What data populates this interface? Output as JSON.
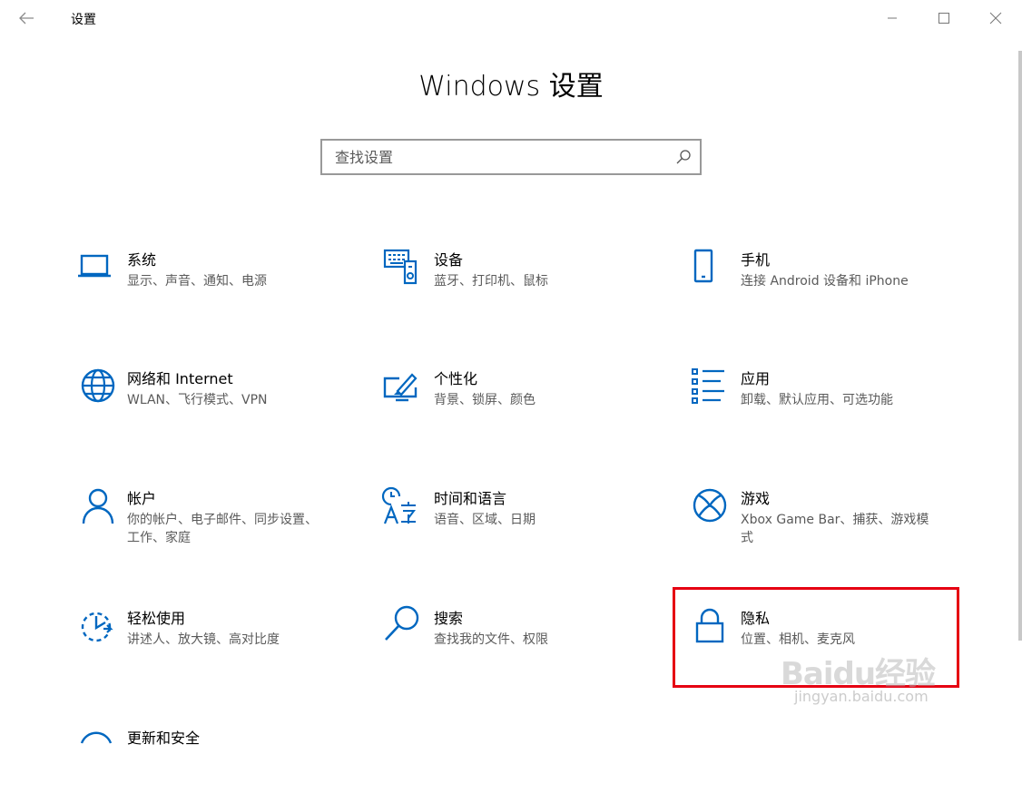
{
  "window": {
    "title": "设置"
  },
  "header": {
    "title": "Windows 设置"
  },
  "search": {
    "placeholder": "查找设置"
  },
  "accent": "#0067c0",
  "tiles": [
    {
      "name": "系统",
      "desc": "显示、声音、通知、电源",
      "icon": "laptop-icon"
    },
    {
      "name": "设备",
      "desc": "蓝牙、打印机、鼠标",
      "icon": "devices-icon"
    },
    {
      "name": "手机",
      "desc": "连接 Android 设备和 iPhone",
      "icon": "phone-icon"
    },
    {
      "name": "网络和 Internet",
      "desc": "WLAN、飞行模式、VPN",
      "icon": "globe-icon"
    },
    {
      "name": "个性化",
      "desc": "背景、锁屏、颜色",
      "icon": "personalization-icon"
    },
    {
      "name": "应用",
      "desc": "卸载、默认应用、可选功能",
      "icon": "apps-list-icon"
    },
    {
      "name": "帐户",
      "desc": "你的帐户、电子邮件、同步设置、工作、家庭",
      "icon": "person-icon"
    },
    {
      "name": "时间和语言",
      "desc": "语音、区域、日期",
      "icon": "time-language-icon"
    },
    {
      "name": "游戏",
      "desc": "Xbox Game Bar、捕获、游戏模式",
      "icon": "xbox-icon"
    },
    {
      "name": "轻松使用",
      "desc": "讲述人、放大镜、高对比度",
      "icon": "ease-of-access-icon"
    },
    {
      "name": "搜索",
      "desc": "查找我的文件、权限",
      "icon": "search-icon"
    },
    {
      "name": "隐私",
      "desc": "位置、相机、麦克风",
      "icon": "lock-icon"
    },
    {
      "name": "更新和安全",
      "desc": "",
      "icon": "update-icon"
    }
  ],
  "watermark": {
    "brand": "Baidu经验",
    "url": "jingyan.baidu.com"
  }
}
